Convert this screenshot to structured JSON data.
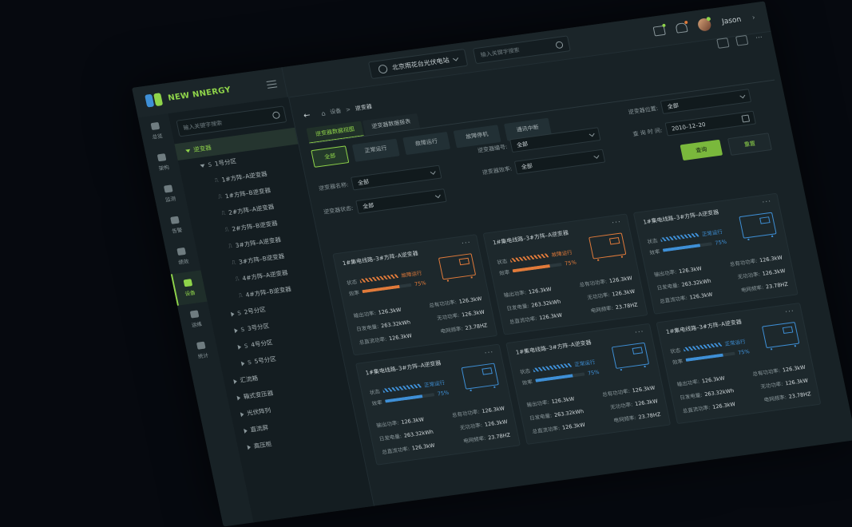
{
  "brand": {
    "name": "NEW NNERGY"
  },
  "header": {
    "station": "北京雨花台光伏电站",
    "search_placeholder": "输入关键字搜索",
    "user": "Jason"
  },
  "nav": [
    {
      "label": "总览",
      "icon": "home-icon"
    },
    {
      "label": "架构",
      "icon": "layers-icon"
    },
    {
      "label": "监测",
      "icon": "pie-icon"
    },
    {
      "label": "告警",
      "icon": "alarm-icon"
    },
    {
      "label": "绩效",
      "icon": "database-icon"
    },
    {
      "label": "设备",
      "icon": "device-icon",
      "active": true
    },
    {
      "label": "运维",
      "icon": "doc-icon"
    },
    {
      "label": "统计",
      "icon": "bar-chart-icon"
    }
  ],
  "tree": {
    "search_placeholder": "输入关键字搜索",
    "rows": [
      {
        "label": "逆变器",
        "level": 0,
        "open": true,
        "selected": true
      },
      {
        "label": "1号分区",
        "level": 1,
        "open": true,
        "icon": "S"
      },
      {
        "label": "1#方阵–A逆变器",
        "level": 2,
        "icon": "⎍"
      },
      {
        "label": "1#方阵–B逆变器",
        "level": 2,
        "icon": "⎍"
      },
      {
        "label": "2#方阵–A逆变器",
        "level": 2,
        "icon": "⎍"
      },
      {
        "label": "2#方阵–B逆变器",
        "level": 2,
        "icon": "⎍"
      },
      {
        "label": "3#方阵–A逆变器",
        "level": 2,
        "icon": "⎍"
      },
      {
        "label": "3#方阵–B逆变器",
        "level": 2,
        "icon": "⎍"
      },
      {
        "label": "4#方阵–A逆变器",
        "level": 2,
        "icon": "⎍"
      },
      {
        "label": "4#方阵–B逆变器",
        "level": 2,
        "icon": "⎍"
      },
      {
        "label": "2号分区",
        "level": 1,
        "icon": "S"
      },
      {
        "label": "3号分区",
        "level": 1,
        "icon": "S"
      },
      {
        "label": "4号分区",
        "level": 1,
        "icon": "S"
      },
      {
        "label": "5号分区",
        "level": 1,
        "icon": "S"
      },
      {
        "label": "汇流箱",
        "level": 0
      },
      {
        "label": "箱式变压器",
        "level": 0
      },
      {
        "label": "光伏阵列",
        "level": 0
      },
      {
        "label": "直流屏",
        "level": 0
      },
      {
        "label": "高压柜",
        "level": 0
      }
    ]
  },
  "breadcrumb": {
    "home": "设备",
    "sep": ">",
    "current": "逆变器"
  },
  "tabs": [
    {
      "label": "逆变器数据视图",
      "active": true
    },
    {
      "label": "逆变器数据报表"
    }
  ],
  "status_buttons": [
    {
      "label": "全部",
      "active": true
    },
    {
      "label": "正常运行"
    },
    {
      "label": "故障运行"
    },
    {
      "label": "故障停机"
    },
    {
      "label": "通讯中断"
    }
  ],
  "filters": {
    "name_label": "逆变器名称:",
    "name_value": "全部",
    "state_label": "逆变器状态:",
    "state_value": "全部",
    "code_label": "逆变器编号:",
    "code_value": "全部",
    "eff_label": "逆变器效率:",
    "eff_value": "全部",
    "pos_label": "逆变器位置:",
    "pos_value": "全部",
    "time_label": "查 询 时 间:",
    "time_value": "2010–12–20",
    "query": "查询",
    "reset": "重置"
  },
  "card_labels": {
    "status": "状态",
    "efficiency": "效率",
    "out_power": "输出功率:",
    "daily": "日发电量:",
    "dc_power": "总直流功率:",
    "active": "总有功功率:",
    "reactive": "无功功率:",
    "freq": "电网频率:"
  },
  "cards": [
    {
      "title": "1#集电线路–3#方阵–A逆变器",
      "status": "故障运行",
      "status_color": "#e07a3a",
      "efficiency": "75%",
      "eff": 0.75,
      "out_power": "126.3kW",
      "daily": "263.32kWh",
      "dc_power": "126.3kW",
      "active": "126.3kW",
      "reactive": "126.3kW",
      "freq": "23.78HZ"
    },
    {
      "title": "1#集电线路–3#方阵–A逆变器",
      "status": "故障运行",
      "status_color": "#e07a3a",
      "efficiency": "75%",
      "eff": 0.75,
      "out_power": "126.3kW",
      "daily": "263.32kWh",
      "dc_power": "126.3kW",
      "active": "126.3kW",
      "reactive": "126.3kW",
      "freq": "23.78HZ"
    },
    {
      "title": "1#集电线路–3#方阵–A逆变器",
      "status": "正常运行",
      "status_color": "#3e8fd6",
      "efficiency": "75%",
      "eff": 0.75,
      "out_power": "126.3kW",
      "daily": "263.32kWh",
      "dc_power": "126.3kW",
      "active": "126.3kW",
      "reactive": "126.3kW",
      "freq": "23.78HZ"
    },
    {
      "title": "1#集电线路–3#方阵–A逆变器",
      "status": "正常运行",
      "status_color": "#3e8fd6",
      "efficiency": "75%",
      "eff": 0.75,
      "out_power": "126.3kW",
      "daily": "263.32kWh",
      "dc_power": "126.3kW",
      "active": "126.3kW",
      "reactive": "126.3kW",
      "freq": "23.78HZ"
    },
    {
      "title": "1#集电线路–3#方阵–A逆变器",
      "status": "正常运行",
      "status_color": "#3e8fd6",
      "efficiency": "75%",
      "eff": 0.75,
      "out_power": "126.3kW",
      "daily": "263.32kWh",
      "dc_power": "126.3kW",
      "active": "126.3kW",
      "reactive": "126.3kW",
      "freq": "23.78HZ"
    },
    {
      "title": "1#集电线路–3#方阵–A逆变器",
      "status": "正常运行",
      "status_color": "#3e8fd6",
      "efficiency": "75%",
      "eff": 0.75,
      "out_power": "126.3kW",
      "daily": "263.32kWh",
      "dc_power": "126.3kW",
      "active": "126.3kW",
      "reactive": "126.3kW",
      "freq": "23.78HZ"
    }
  ],
  "colors": {
    "accent": "#8fd44a",
    "fault": "#e07a3a",
    "normal": "#3e8fd6",
    "logo_a": "#3e8fd6",
    "logo_b": "#8fd44a"
  }
}
